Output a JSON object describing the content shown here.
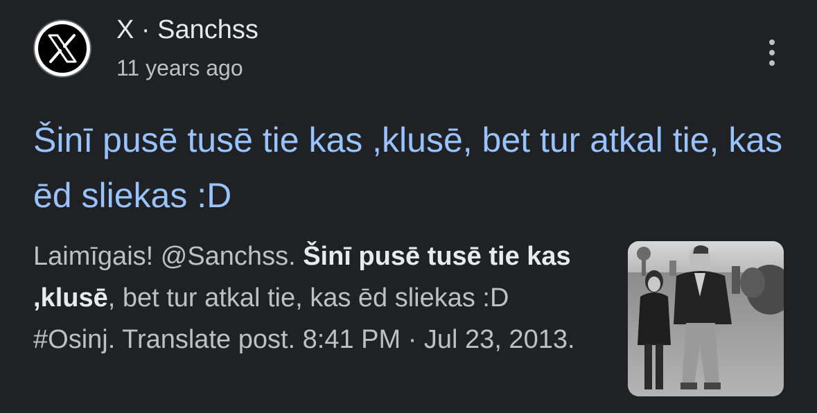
{
  "result": {
    "source": {
      "site": "X",
      "separator": " · ",
      "author": "Sanchss",
      "logo_icon": "x-logo-icon"
    },
    "time": "11 years ago",
    "menu_icon": "more-vert-icon",
    "title": "Šinī pusē tusē tie kas ,klusē, bet tur atkal tie, kas ēd sliekas :D",
    "snippet": {
      "before": "Laimīgais! @Sanchss. ",
      "bold": "Šinī pusē tusē tie kas ,klusē",
      "after": ", bet tur atkal tie, kas ēd sliekas :D #Osinj. Translate post. 8:41 PM · Jul 23, 2013."
    },
    "thumbnail_icon": "photo-thumbnail"
  },
  "colors": {
    "background": "#202124",
    "title_link": "#99c3ff",
    "primary_text": "#e8eaed",
    "secondary_text": "#bdc1c6"
  }
}
